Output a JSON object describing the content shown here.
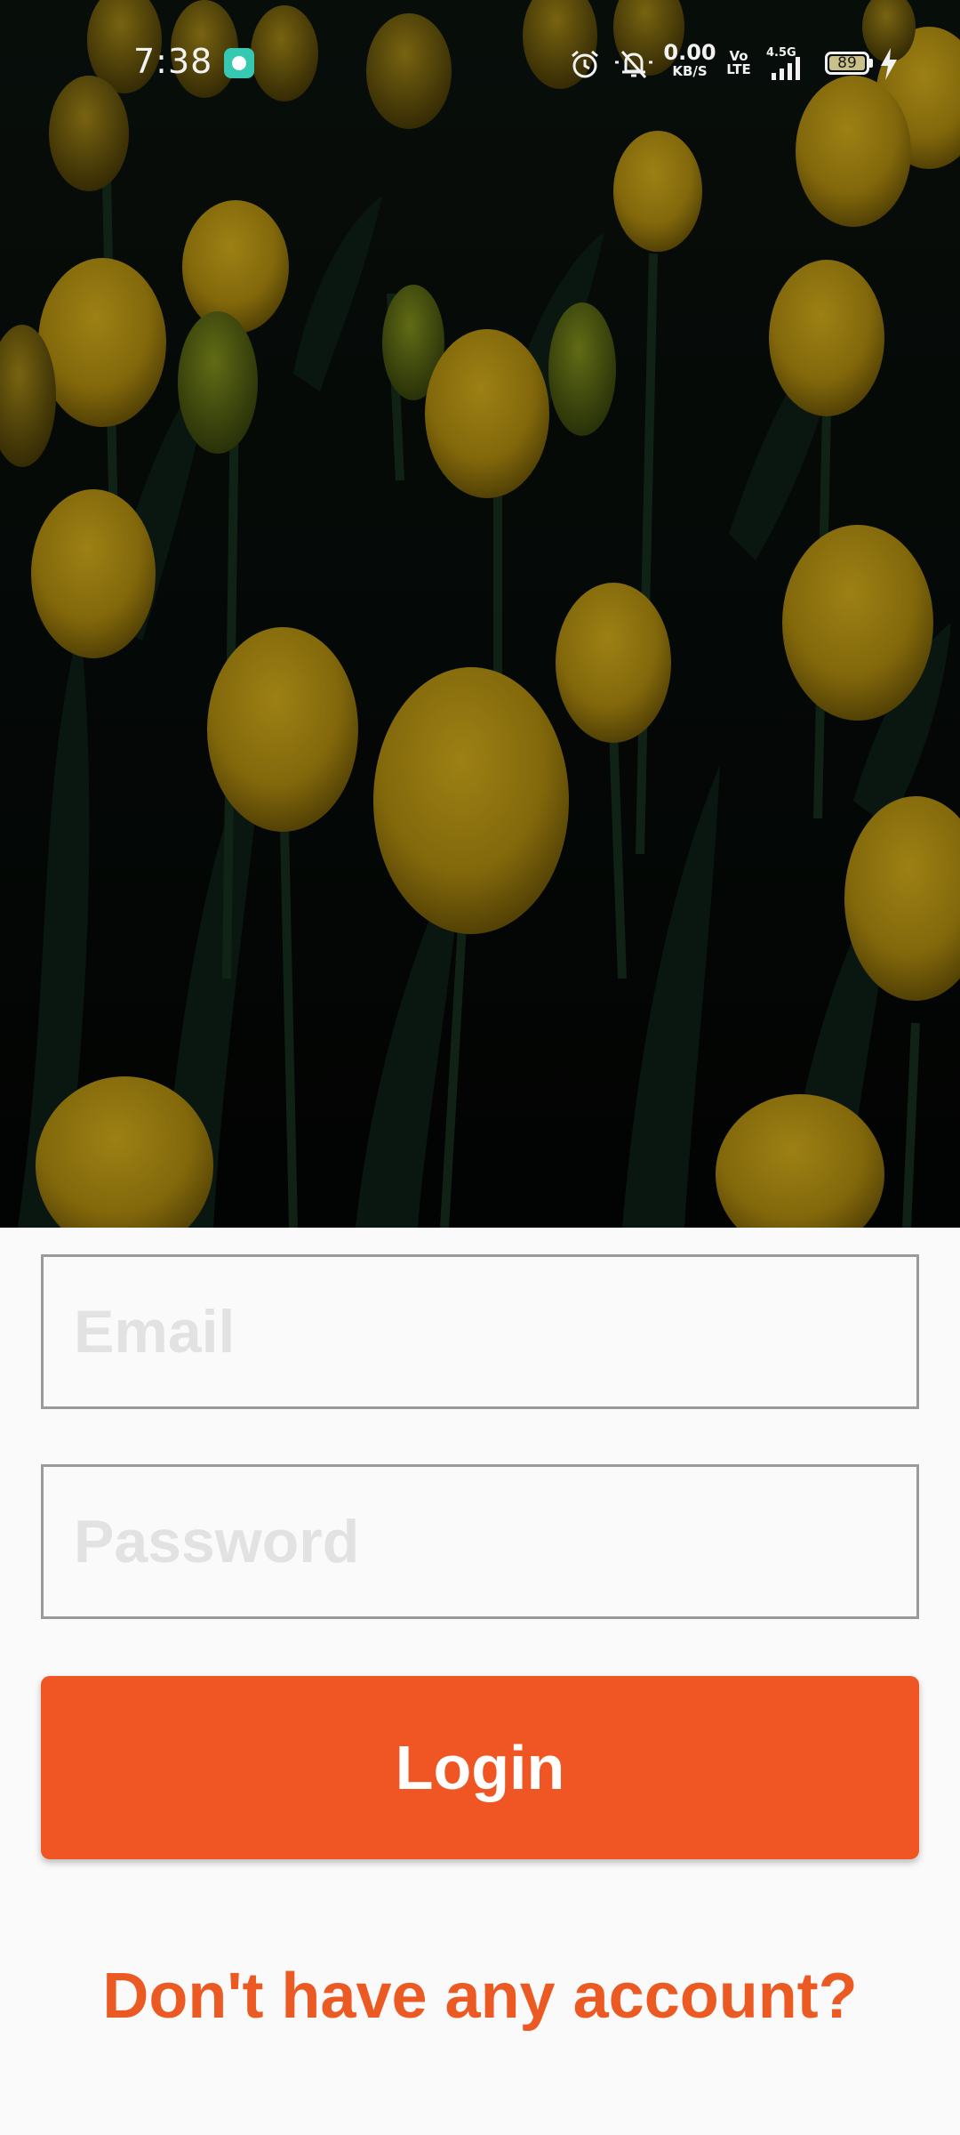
{
  "status_bar": {
    "time": "7:38",
    "net_speed_value": "0.00",
    "net_speed_unit": "KB/S",
    "volte_top": "Vo",
    "volte_bottom": "LTE",
    "network_type": "4.5G",
    "battery_level": "89",
    "icons": [
      "app-notification-icon",
      "alarm-icon",
      "silent-bell-icon",
      "signal-icon",
      "battery-icon",
      "charging-bolt-icon"
    ]
  },
  "hero": {
    "image_subject": "yellow tulips"
  },
  "form": {
    "email_placeholder": "Email",
    "password_placeholder": "Password",
    "login_label": "Login",
    "signup_link": "Don't have any account?"
  },
  "colors": {
    "accent": "#f05624",
    "link": "#ec5a24",
    "background": "#fafafa",
    "field_border": "#9a9a9a",
    "placeholder": "#e2e2e2"
  }
}
